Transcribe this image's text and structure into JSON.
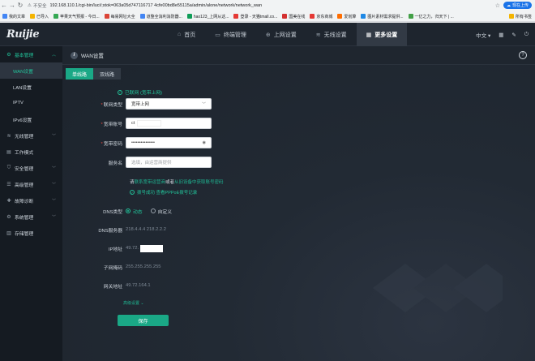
{
  "browser": {
    "insecure_label": "不安全",
    "url": "192.168.110.1/cgi-bin/luci/;stok=063a05d747116717 4cfe00bd8e55115a/admin/alone/network/network_wan",
    "sync_label": "现在上传",
    "bookmarks": [
      {
        "label": "我的文章",
        "color": "#4285f4"
      },
      {
        "label": "已导入",
        "color": "#f4b400"
      },
      {
        "label": "苹果天气预报 - 今日...",
        "color": "#34a853"
      },
      {
        "label": "每易网址大全",
        "color": "#db4437"
      },
      {
        "label": "道整全消利消防器...",
        "color": "#4285f4"
      },
      {
        "label": "hao123_上网从这...",
        "color": "#0f9d58"
      },
      {
        "label": "登录 - 天猫tmall.co...",
        "color": "#e53935"
      },
      {
        "label": "国美在线",
        "color": "#d32f2f"
      },
      {
        "label": "京东商城",
        "color": "#e53935"
      },
      {
        "label": "爱划算",
        "color": "#ff6d00"
      },
      {
        "label": "图片素材需求提供...",
        "color": "#1e88e5"
      },
      {
        "label": "一亿之力，归天下 | ...",
        "color": "#43a047"
      }
    ],
    "bm_right": "所有书签"
  },
  "topnav": {
    "logo": "Ruijie",
    "items": [
      {
        "label": "首页",
        "icon": "home-icon"
      },
      {
        "label": "终端管理",
        "icon": "devices-icon"
      },
      {
        "label": "上网设置",
        "icon": "globe-icon"
      },
      {
        "label": "无线设置",
        "icon": "wifi-icon"
      },
      {
        "label": "更多设置",
        "icon": "grid-icon"
      }
    ],
    "language": "中文"
  },
  "sidebar": {
    "basic": "基本管理",
    "sub": [
      "WAN设置",
      "LAN设置",
      "IPTV",
      "IPv6设置"
    ],
    "items": [
      "无线管理",
      "工作模式",
      "安全管理",
      "高级管理",
      "故障诊断",
      "系统管理",
      "存储管理"
    ]
  },
  "page": {
    "title": "WAN设置",
    "tabs": [
      "单线路",
      "双线路"
    ],
    "status": "已联网 (宽带上网)",
    "conn_type_label": "联网类型",
    "conn_type_value": "宽带上网",
    "account_label": "宽带账号",
    "account_value": "ct",
    "password_label": "宽带密码",
    "password_value": "•••••••••••••••",
    "service_label": "服务名",
    "service_placeholder": "选填，由运营商提供",
    "hint_prefix": "请",
    "hint_link1": "联系宽带运营商",
    "hint_mid": "或者",
    "hint_link2": "从旧设备中获取账号密码",
    "hint2_text": "拨号成功 查看PPPoE拨号记录",
    "dns_type_label": "DNS类型",
    "dns_auto": "动态",
    "dns_custom": "自定义",
    "dns_server_label": "DNS服务器",
    "dns_server_value": "218.4.4.4 218.2.2.2",
    "ip_label": "IP地址",
    "ip_value": "49.72.",
    "mask_label": "子网掩码",
    "mask_value": "255.255.255.255",
    "gateway_label": "网关地址",
    "gateway_value": "49.72.164.1",
    "advanced": "高级设置 ⌄",
    "save": "保存"
  }
}
